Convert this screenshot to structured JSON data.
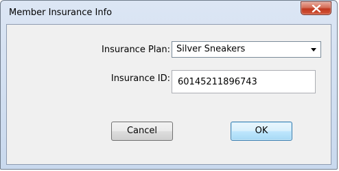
{
  "window": {
    "title": "Member Insurance Info"
  },
  "form": {
    "plan_label": "Insurance Plan:",
    "plan_value": "Silver Sneakers",
    "id_label": "Insurance ID:",
    "id_value": "60145211896743"
  },
  "buttons": {
    "cancel_label": "Cancel",
    "ok_label": "OK"
  },
  "icons": {
    "close": "close-icon",
    "dropdown": "chevron-down-icon"
  },
  "colors": {
    "close_button": "#c0391f",
    "ok_border": "#3c7fb1",
    "frame": "#c9d9ee"
  }
}
